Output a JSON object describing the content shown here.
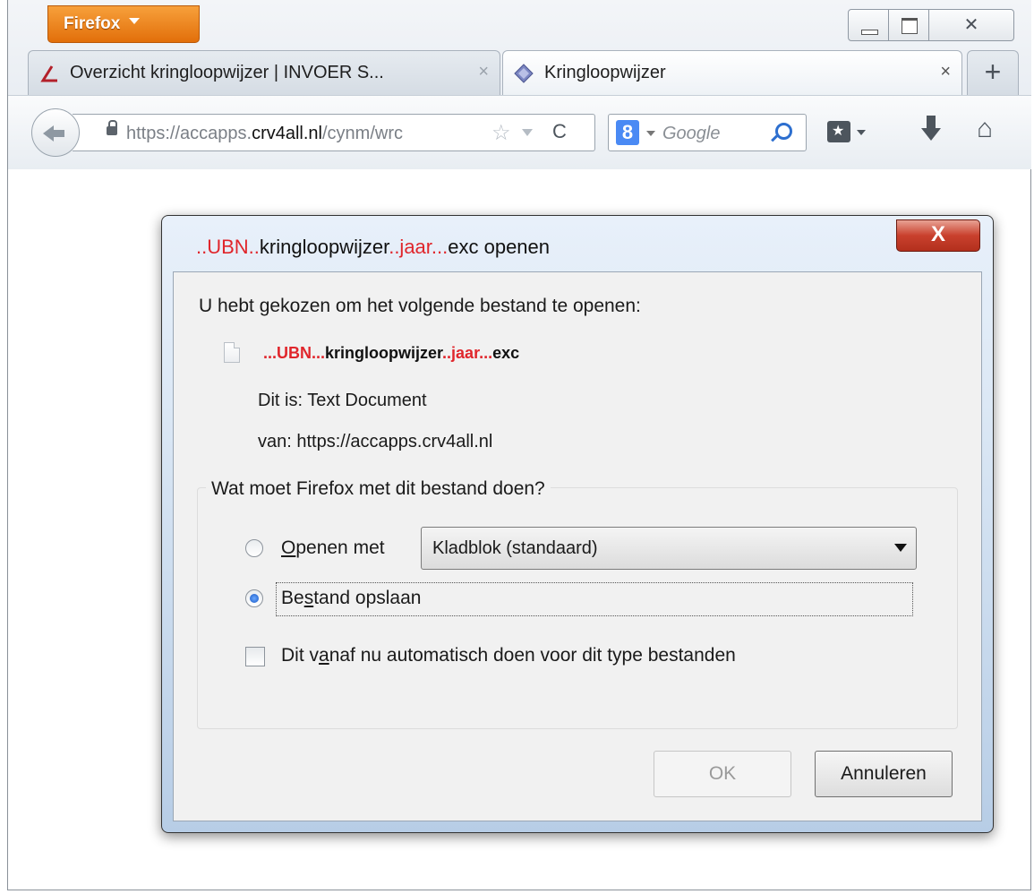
{
  "browser": {
    "menu_button": "Firefox",
    "tabs": [
      {
        "label": "Overzicht kringloopwijzer | INVOER S...",
        "active": false
      },
      {
        "label": "Kringloopwijzer",
        "active": true
      }
    ],
    "new_tab": "+",
    "tab_close": "×",
    "url": {
      "pre": "https://accapps.",
      "host": "crv4all.nl",
      "post": "/cynm/wrc"
    },
    "search_placeholder": "Google",
    "search_engine_glyph": "8",
    "window_controls": {
      "close": "✕"
    },
    "star_glyph": "☆",
    "reload_glyph": "C",
    "home_glyph": "⌂"
  },
  "dialog": {
    "title": {
      "a": "..UBN..",
      "b": "kringloopwijzer",
      "c": "..jaar...",
      "d": "exc openen"
    },
    "close_glyph": "X",
    "intro": "U hebt gekozen om het volgende bestand te openen:",
    "filename": {
      "a": "...UBN...",
      "b": "kringloopwijzer",
      "c": "..jaar...",
      "d": "exc"
    },
    "type_line": "Dit is:  Text Document",
    "from_line": "van:  https://accapps.crv4all.nl",
    "group_label": "Wat moet Firefox met dit bestand doen?",
    "option_open": {
      "first": "O",
      "rest": "penen met"
    },
    "open_with_value": "Kladblok (standaard)",
    "option_save": {
      "a": "Be",
      "u": "s",
      "b": "tand opslaan"
    },
    "auto_checkbox": {
      "a": "Dit v",
      "u": "a",
      "b": "naf nu automatisch doen voor dit type bestanden"
    },
    "selected_option": "Bestand opslaan",
    "ok_button": "OK",
    "cancel_button": "Annuleren"
  }
}
